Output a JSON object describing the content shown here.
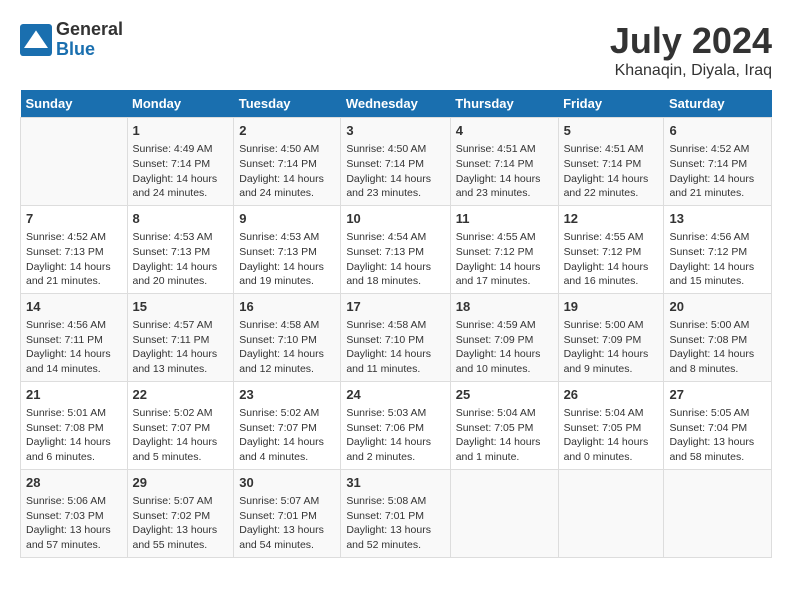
{
  "header": {
    "logo_general": "General",
    "logo_blue": "Blue",
    "month_year": "July 2024",
    "location": "Khanaqin, Diyala, Iraq"
  },
  "days_of_week": [
    "Sunday",
    "Monday",
    "Tuesday",
    "Wednesday",
    "Thursday",
    "Friday",
    "Saturday"
  ],
  "weeks": [
    [
      {
        "day": "",
        "info": ""
      },
      {
        "day": "1",
        "info": "Sunrise: 4:49 AM\nSunset: 7:14 PM\nDaylight: 14 hours\nand 24 minutes."
      },
      {
        "day": "2",
        "info": "Sunrise: 4:50 AM\nSunset: 7:14 PM\nDaylight: 14 hours\nand 24 minutes."
      },
      {
        "day": "3",
        "info": "Sunrise: 4:50 AM\nSunset: 7:14 PM\nDaylight: 14 hours\nand 23 minutes."
      },
      {
        "day": "4",
        "info": "Sunrise: 4:51 AM\nSunset: 7:14 PM\nDaylight: 14 hours\nand 23 minutes."
      },
      {
        "day": "5",
        "info": "Sunrise: 4:51 AM\nSunset: 7:14 PM\nDaylight: 14 hours\nand 22 minutes."
      },
      {
        "day": "6",
        "info": "Sunrise: 4:52 AM\nSunset: 7:14 PM\nDaylight: 14 hours\nand 21 minutes."
      }
    ],
    [
      {
        "day": "7",
        "info": "Sunrise: 4:52 AM\nSunset: 7:13 PM\nDaylight: 14 hours\nand 21 minutes."
      },
      {
        "day": "8",
        "info": "Sunrise: 4:53 AM\nSunset: 7:13 PM\nDaylight: 14 hours\nand 20 minutes."
      },
      {
        "day": "9",
        "info": "Sunrise: 4:53 AM\nSunset: 7:13 PM\nDaylight: 14 hours\nand 19 minutes."
      },
      {
        "day": "10",
        "info": "Sunrise: 4:54 AM\nSunset: 7:13 PM\nDaylight: 14 hours\nand 18 minutes."
      },
      {
        "day": "11",
        "info": "Sunrise: 4:55 AM\nSunset: 7:12 PM\nDaylight: 14 hours\nand 17 minutes."
      },
      {
        "day": "12",
        "info": "Sunrise: 4:55 AM\nSunset: 7:12 PM\nDaylight: 14 hours\nand 16 minutes."
      },
      {
        "day": "13",
        "info": "Sunrise: 4:56 AM\nSunset: 7:12 PM\nDaylight: 14 hours\nand 15 minutes."
      }
    ],
    [
      {
        "day": "14",
        "info": "Sunrise: 4:56 AM\nSunset: 7:11 PM\nDaylight: 14 hours\nand 14 minutes."
      },
      {
        "day": "15",
        "info": "Sunrise: 4:57 AM\nSunset: 7:11 PM\nDaylight: 14 hours\nand 13 minutes."
      },
      {
        "day": "16",
        "info": "Sunrise: 4:58 AM\nSunset: 7:10 PM\nDaylight: 14 hours\nand 12 minutes."
      },
      {
        "day": "17",
        "info": "Sunrise: 4:58 AM\nSunset: 7:10 PM\nDaylight: 14 hours\nand 11 minutes."
      },
      {
        "day": "18",
        "info": "Sunrise: 4:59 AM\nSunset: 7:09 PM\nDaylight: 14 hours\nand 10 minutes."
      },
      {
        "day": "19",
        "info": "Sunrise: 5:00 AM\nSunset: 7:09 PM\nDaylight: 14 hours\nand 9 minutes."
      },
      {
        "day": "20",
        "info": "Sunrise: 5:00 AM\nSunset: 7:08 PM\nDaylight: 14 hours\nand 8 minutes."
      }
    ],
    [
      {
        "day": "21",
        "info": "Sunrise: 5:01 AM\nSunset: 7:08 PM\nDaylight: 14 hours\nand 6 minutes."
      },
      {
        "day": "22",
        "info": "Sunrise: 5:02 AM\nSunset: 7:07 PM\nDaylight: 14 hours\nand 5 minutes."
      },
      {
        "day": "23",
        "info": "Sunrise: 5:02 AM\nSunset: 7:07 PM\nDaylight: 14 hours\nand 4 minutes."
      },
      {
        "day": "24",
        "info": "Sunrise: 5:03 AM\nSunset: 7:06 PM\nDaylight: 14 hours\nand 2 minutes."
      },
      {
        "day": "25",
        "info": "Sunrise: 5:04 AM\nSunset: 7:05 PM\nDaylight: 14 hours\nand 1 minute."
      },
      {
        "day": "26",
        "info": "Sunrise: 5:04 AM\nSunset: 7:05 PM\nDaylight: 14 hours\nand 0 minutes."
      },
      {
        "day": "27",
        "info": "Sunrise: 5:05 AM\nSunset: 7:04 PM\nDaylight: 13 hours\nand 58 minutes."
      }
    ],
    [
      {
        "day": "28",
        "info": "Sunrise: 5:06 AM\nSunset: 7:03 PM\nDaylight: 13 hours\nand 57 minutes."
      },
      {
        "day": "29",
        "info": "Sunrise: 5:07 AM\nSunset: 7:02 PM\nDaylight: 13 hours\nand 55 minutes."
      },
      {
        "day": "30",
        "info": "Sunrise: 5:07 AM\nSunset: 7:01 PM\nDaylight: 13 hours\nand 54 minutes."
      },
      {
        "day": "31",
        "info": "Sunrise: 5:08 AM\nSunset: 7:01 PM\nDaylight: 13 hours\nand 52 minutes."
      },
      {
        "day": "",
        "info": ""
      },
      {
        "day": "",
        "info": ""
      },
      {
        "day": "",
        "info": ""
      }
    ]
  ]
}
